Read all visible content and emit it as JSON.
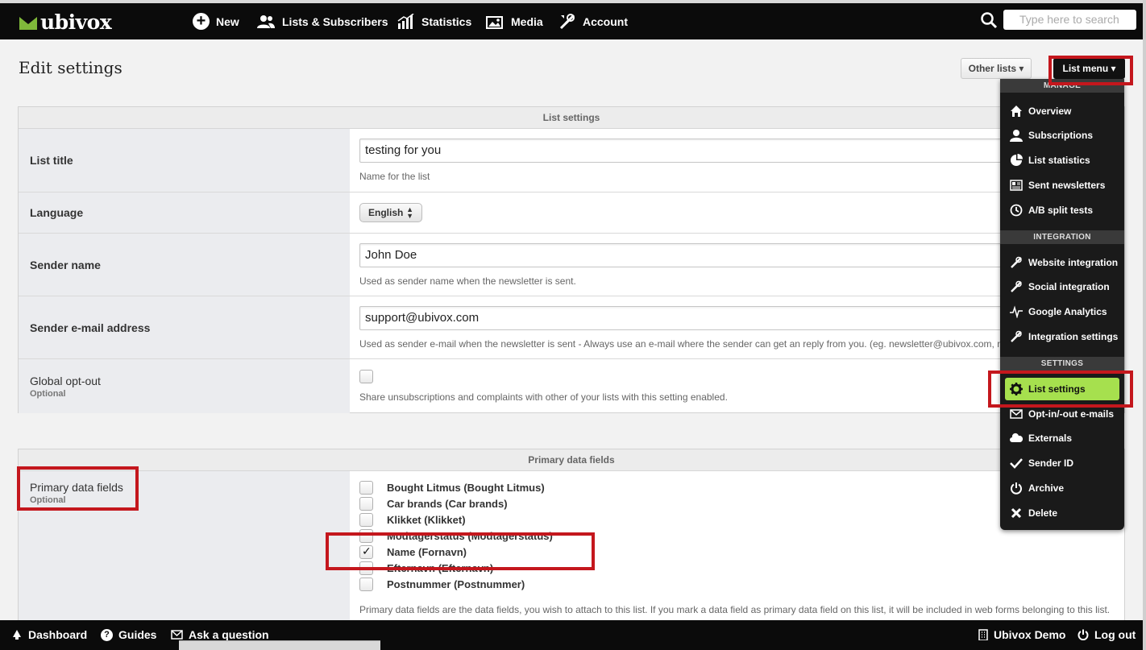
{
  "header": {
    "logo_text": "ubivox",
    "nav": [
      {
        "label": "New",
        "icon": "plus-circle-icon"
      },
      {
        "label": "Lists & Subscribers",
        "icon": "users-icon"
      },
      {
        "label": "Statistics",
        "icon": "bar-chart-icon"
      },
      {
        "label": "Media",
        "icon": "image-icon"
      },
      {
        "label": "Account",
        "icon": "tools-icon"
      }
    ],
    "search_placeholder": "Type here to search"
  },
  "page": {
    "title": "Edit settings",
    "other_lists": "Other lists ▾",
    "list_menu": "List menu ▾"
  },
  "list_settings": {
    "heading": "List settings",
    "list_title": {
      "label": "List title",
      "value": "testing for you",
      "help": "Name for the list"
    },
    "language": {
      "label": "Language",
      "value": "English"
    },
    "sender_name": {
      "label": "Sender name",
      "value": "John Doe",
      "help": "Used as sender name when the newsletter is sent."
    },
    "sender_email": {
      "label": "Sender e-mail address",
      "value": "support@ubivox.com",
      "help": "Used as sender e-mail when the newsletter is sent - Always use an e-mail where the sender can get an reply from you. (eg. newsletter@ubivox.com, no"
    },
    "global_optout": {
      "label": "Global opt-out",
      "optional": "Optional",
      "help": "Share unsubscriptions and complaints with other of your lists with this setting enabled."
    }
  },
  "primary_fields": {
    "heading": "Primary data fields",
    "label": "Primary data fields",
    "optional": "Optional",
    "items": [
      {
        "label": "Bought Litmus (Bought Litmus)",
        "checked": false
      },
      {
        "label": "Car brands (Car brands)",
        "checked": false
      },
      {
        "label": "Klikket (Klikket)",
        "checked": false
      },
      {
        "label": "Modtagerstatus (Modtagerstatus)",
        "checked": false
      },
      {
        "label": "Name (Fornavn)",
        "checked": true
      },
      {
        "label": "Efternavn (Efternavn)",
        "checked": false
      },
      {
        "label": "Postnummer (Postnummer)",
        "checked": false
      }
    ],
    "help": "Primary data fields are the data fields, you wish to attach to this list. If you mark a data field as primary data field on this list, it will be included in web forms belonging to this list."
  },
  "list_menu": {
    "sections": [
      {
        "title": "MANAGE",
        "items": [
          {
            "label": "Overview",
            "icon": "home-icon"
          },
          {
            "label": "Subscriptions",
            "icon": "user-icon"
          },
          {
            "label": "List statistics",
            "icon": "pie-chart-icon"
          },
          {
            "label": "Sent newsletters",
            "icon": "newspaper-icon"
          },
          {
            "label": "A/B split tests",
            "icon": "clock-icon"
          }
        ]
      },
      {
        "title": "INTEGRATION",
        "items": [
          {
            "label": "Website integration",
            "icon": "tools-icon"
          },
          {
            "label": "Social integration",
            "icon": "tools-icon"
          },
          {
            "label": "Google Analytics",
            "icon": "pulse-icon"
          },
          {
            "label": "Integration settings",
            "icon": "tools-icon"
          }
        ]
      },
      {
        "title": "SETTINGS",
        "items": [
          {
            "label": "List settings",
            "icon": "gear-icon",
            "active": true
          },
          {
            "label": "Opt-in/-out e-mails",
            "icon": "envelope-icon"
          },
          {
            "label": "Externals",
            "icon": "cloud-icon"
          },
          {
            "label": "Sender ID",
            "icon": "checkmark-icon"
          },
          {
            "label": "Archive",
            "icon": "power-icon"
          },
          {
            "label": "Delete",
            "icon": "x-icon"
          }
        ]
      }
    ]
  },
  "footer": {
    "left": [
      {
        "label": "Dashboard",
        "icon": "bell-icon"
      },
      {
        "label": "Guides",
        "icon": "question-icon"
      },
      {
        "label": "Ask a question",
        "icon": "envelope-icon"
      }
    ],
    "right": [
      {
        "label": "Ubivox Demo",
        "icon": "building-icon"
      },
      {
        "label": "Log out",
        "icon": "power-icon"
      }
    ]
  },
  "colors": {
    "highlight": "#c4171d",
    "active_menu": "#a6e04e",
    "brand_green": "#7fb93a"
  }
}
